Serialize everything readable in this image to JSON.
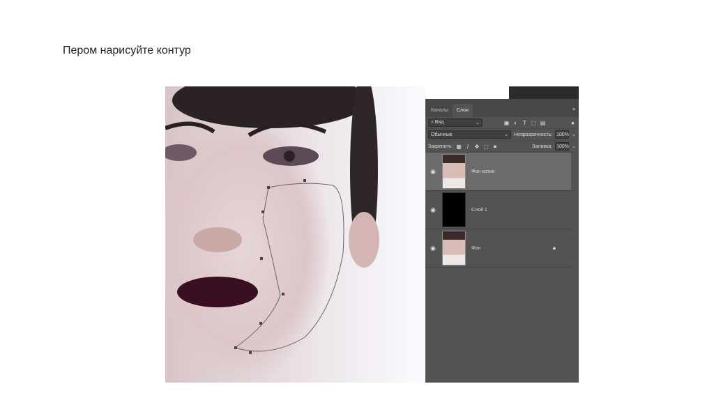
{
  "slide": {
    "title": "Пером нарисуйте контур"
  },
  "panel": {
    "tabs": [
      {
        "label": "Каналы"
      },
      {
        "label": "Слои"
      }
    ],
    "filter": "Вид",
    "blend_mode": "Обычные",
    "opacity_label": "Непрозрачность:",
    "opacity_value": "100%",
    "lock_label": "Закрепить:",
    "fill_label": "Заливка:",
    "fill_value": "100%",
    "layers": [
      {
        "name": "Фон копия",
        "active": true
      },
      {
        "name": "Слой 1"
      },
      {
        "name": "Фон",
        "locked": true
      }
    ]
  }
}
